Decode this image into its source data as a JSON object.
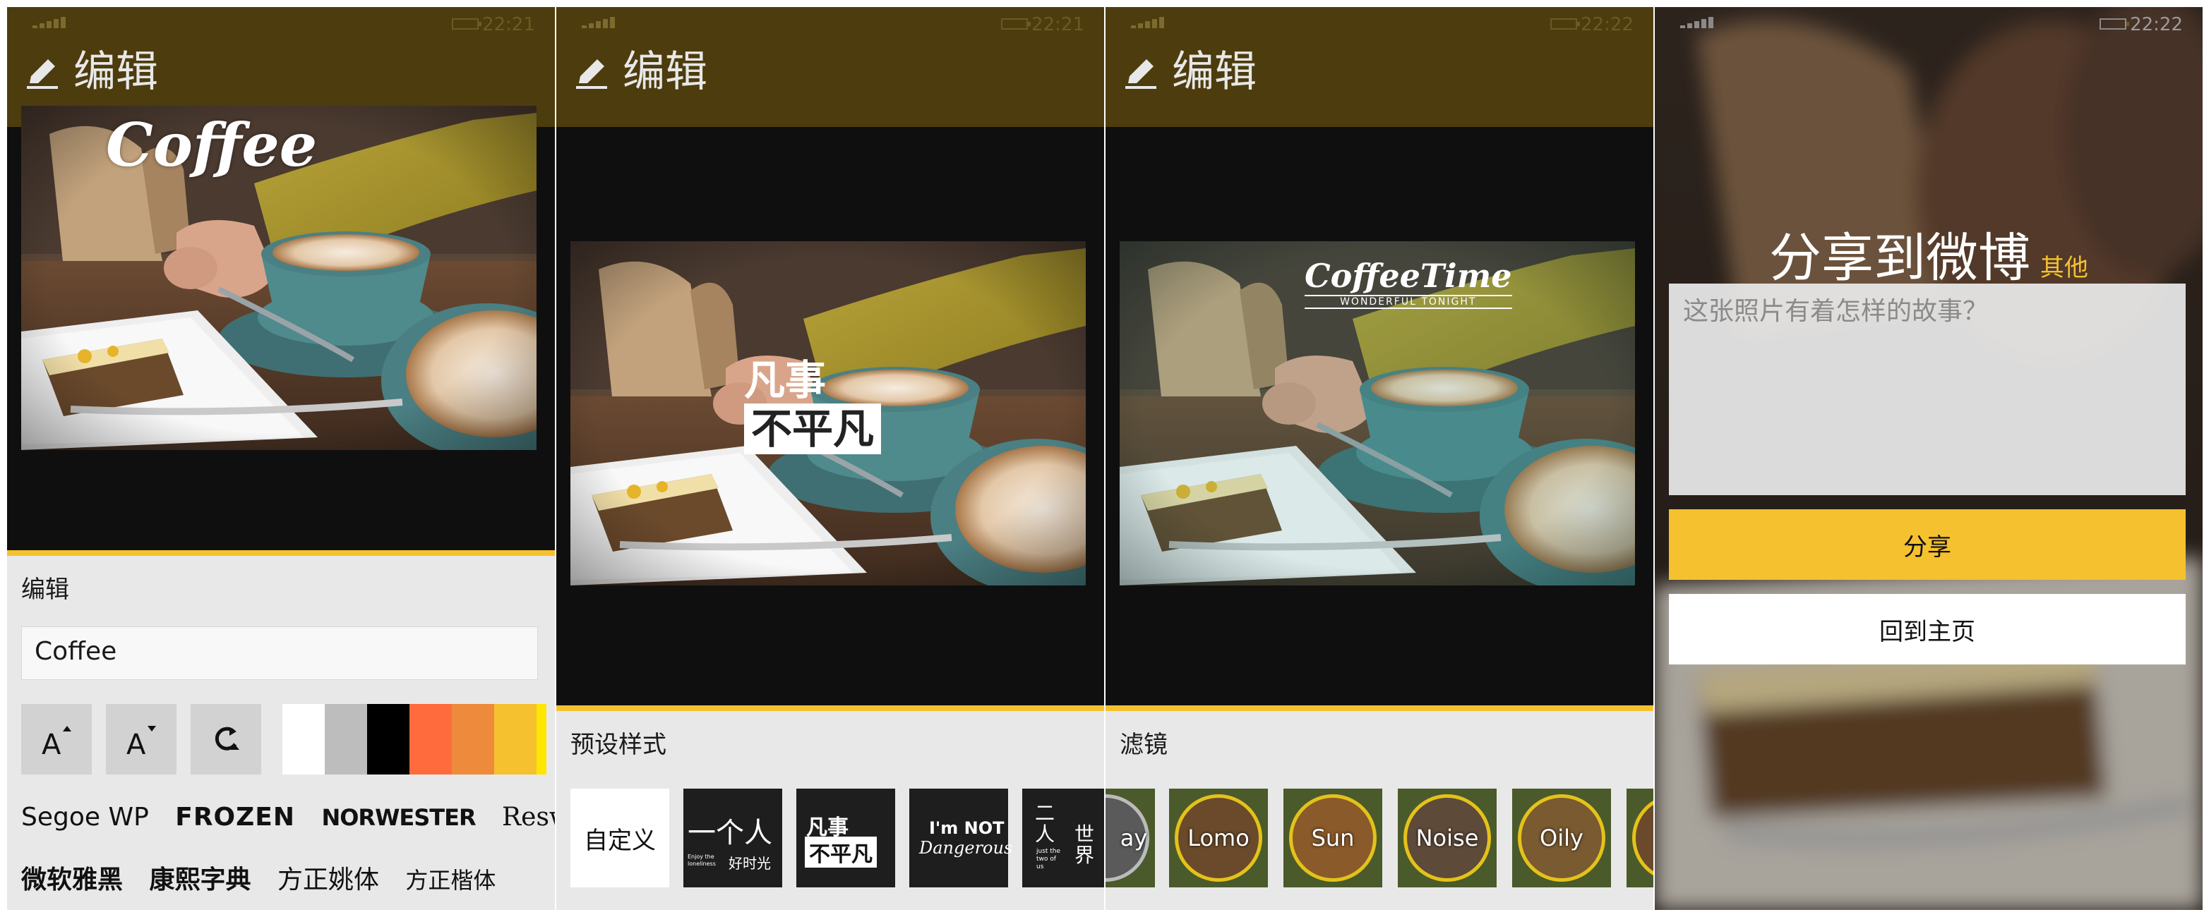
{
  "status": {
    "time1": "22:21",
    "time2": "22:21",
    "time3": "22:22",
    "time4": "22:22"
  },
  "header": {
    "title": "编辑"
  },
  "panel1": {
    "overlay_text": "Coffee",
    "section_title": "编辑",
    "text_value": "Coffee",
    "swatches": [
      "#ffffff",
      "#bdbdbd",
      "#000000",
      "#ff6b3d",
      "#ee8a3c",
      "#f5c12f",
      "#ffe600"
    ],
    "fonts_latin": [
      "Segoe WP",
      "FROZEN",
      "NORWESTER",
      "Reswysokr"
    ],
    "fonts_cjk": [
      "微软雅黑",
      "康熙字典",
      "方正姚体",
      "方正楷体"
    ]
  },
  "panel2": {
    "section_title": "预设样式",
    "overlay_line1": "凡事",
    "overlay_line2": "不平凡",
    "tiles": [
      {
        "label": "自定义"
      },
      {
        "main": "一个人",
        "sub": "好时光",
        "small": "Enjoy the loneliness"
      },
      {
        "line1": "凡事",
        "line2": "不平凡"
      },
      {
        "line1": "I'm NOT",
        "line2": "Dangerous"
      },
      {
        "line1": "二人",
        "line2": "世界",
        "small": "just the two of us"
      }
    ]
  },
  "panel3": {
    "section_title": "滤镜",
    "overlay_main": "CoffeeTime",
    "overlay_sub": "WONDERFUL TONIGHT",
    "filters": [
      "ay",
      "Lomo",
      "Sun",
      "Noise",
      "Oily"
    ]
  },
  "panel4": {
    "title": "分享到微博",
    "other": "其他",
    "placeholder": "这张照片有着怎样的故事？",
    "share_button": "分享",
    "home_button": "回到主页"
  },
  "colors": {
    "accent": "#f5c12f",
    "header_bg": "#4d3c0d",
    "tools_bg": "#e8e8e8",
    "canvas_bg": "#0f0f0f"
  }
}
